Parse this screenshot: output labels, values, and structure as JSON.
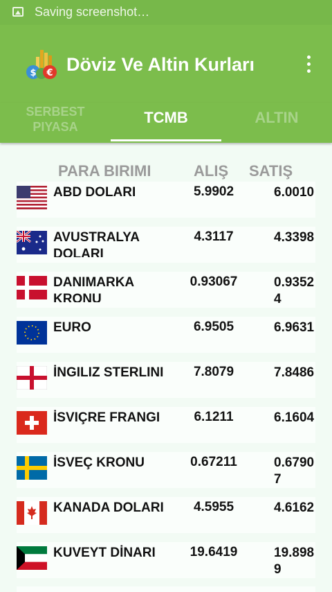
{
  "status_bar": {
    "text": "Saving screenshot…"
  },
  "app_bar": {
    "title": "Döviz Ve Altin Kurları"
  },
  "tabs": [
    {
      "line1": "SERBEST",
      "line2": "PIYASA"
    },
    {
      "label": "TCMB"
    },
    {
      "label": "ALTIN"
    }
  ],
  "table": {
    "headers": {
      "currency": "PARA BIRIMI",
      "buy": "ALIŞ",
      "sell": "SATIŞ"
    },
    "rows": [
      {
        "name": "ABD DOLARI",
        "buy": "5.9902",
        "sell": "6.0010",
        "flag": "us-flag"
      },
      {
        "name": "AVUSTRALYA DOLARI",
        "buy": "4.3117",
        "sell": "4.3398",
        "flag": "australia-flag"
      },
      {
        "name": "DANIMARKA KRONU",
        "buy": "0.93067",
        "sell": "0.93524",
        "flag": "denmark-flag"
      },
      {
        "name": "EURO",
        "buy": "6.9505",
        "sell": "6.9631",
        "flag": "eu-flag"
      },
      {
        "name": "İNGILIZ STERLINI",
        "buy": "7.8079",
        "sell": "7.8486",
        "flag": "england-flag"
      },
      {
        "name": "İSVIÇRE FRANGI",
        "buy": "6.1211",
        "sell": "6.1604",
        "flag": "switzerland-flag"
      },
      {
        "name": "İSVEÇ KRONU",
        "buy": "0.67211",
        "sell": "0.67907",
        "flag": "sweden-flag"
      },
      {
        "name": "KANADA DOLARI",
        "buy": "4.5955",
        "sell": "4.6162",
        "flag": "canada-flag"
      },
      {
        "name": "KUVEYT DİNARI",
        "buy": "19.6419",
        "sell": "19.8989",
        "flag": "kuwait-flag"
      }
    ]
  }
}
